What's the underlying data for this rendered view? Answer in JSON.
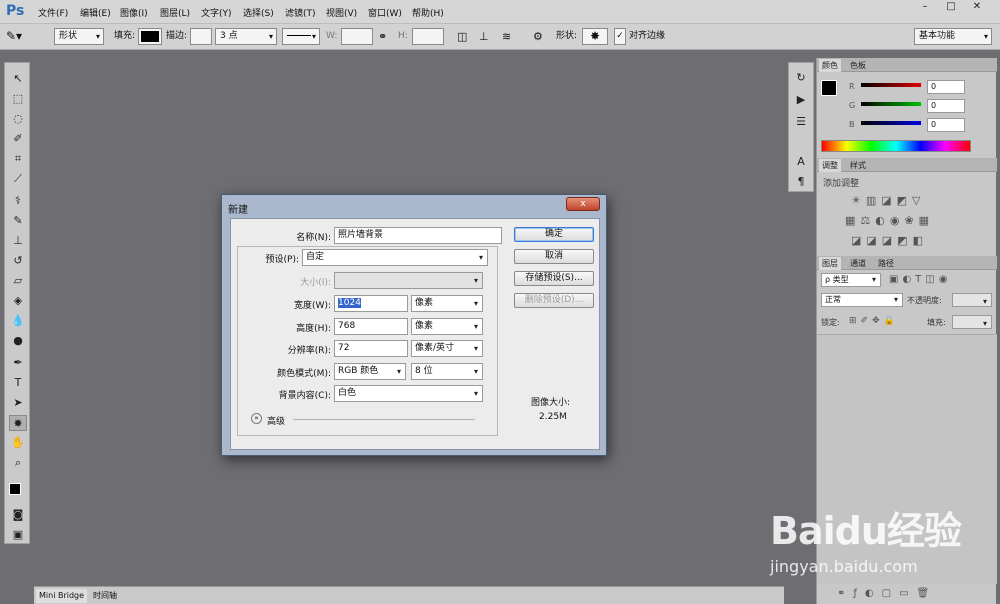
{
  "app": {
    "logo": "Ps"
  },
  "menubar": {
    "items": [
      "文件(F)",
      "编辑(E)",
      "图像(I)",
      "图层(L)",
      "文字(Y)",
      "选择(S)",
      "滤镜(T)",
      "视图(V)",
      "窗口(W)",
      "帮助(H)"
    ],
    "window_buttons": [
      "–",
      "□",
      "✕"
    ]
  },
  "options_bar": {
    "mode": "形状",
    "fill_label": "填充:",
    "stroke_label": "描边:",
    "stroke_size": "3 点",
    "w_label": "W:",
    "h_label": "H:",
    "shape_label": "形状:",
    "align_edges": "对齐边缘",
    "workspace": "基本功能"
  },
  "bottom_tabs": [
    "Mini Bridge",
    "时间轴"
  ],
  "right_panels": {
    "color_tabs": [
      "颜色",
      "色板"
    ],
    "r_label": "R",
    "g_label": "G",
    "b_label": "B",
    "r_value": "0",
    "g_value": "0",
    "b_value": "0",
    "adjust_tabs": [
      "调整",
      "样式"
    ],
    "adjust_title": "添加调整",
    "layers_tabs": [
      "图层",
      "通道",
      "路径"
    ],
    "kind_select": "ρ 类型",
    "blend_mode": "正常",
    "opacity_label": "不透明度:",
    "lock_label": "锁定:",
    "fill_label": "填充:"
  },
  "dialog": {
    "title": "新建",
    "close": "x",
    "name_label": "名称(N):",
    "name_value": "照片墙背景",
    "preset_label": "预设(P):",
    "preset_value": "自定",
    "size_label": "大小(I):",
    "width_label": "宽度(W):",
    "width_value": "1024",
    "width_unit": "像素",
    "height_label": "高度(H):",
    "height_value": "768",
    "height_unit": "像素",
    "resolution_label": "分辨率(R):",
    "resolution_value": "72",
    "resolution_unit": "像素/英寸",
    "color_mode_label": "颜色模式(M):",
    "color_mode_value": "RGB 颜色",
    "bit_depth": "8 位",
    "bg_label": "背景内容(C):",
    "bg_value": "白色",
    "advanced": "高级",
    "ok": "确定",
    "cancel": "取消",
    "save_preset": "存储预设(S)...",
    "delete_preset": "删除预设(D)...",
    "image_size_label": "图像大小:",
    "image_size_value": "2.25M"
  },
  "watermark": {
    "brand": "Baidu经验",
    "url": "jingyan.baidu.com"
  }
}
